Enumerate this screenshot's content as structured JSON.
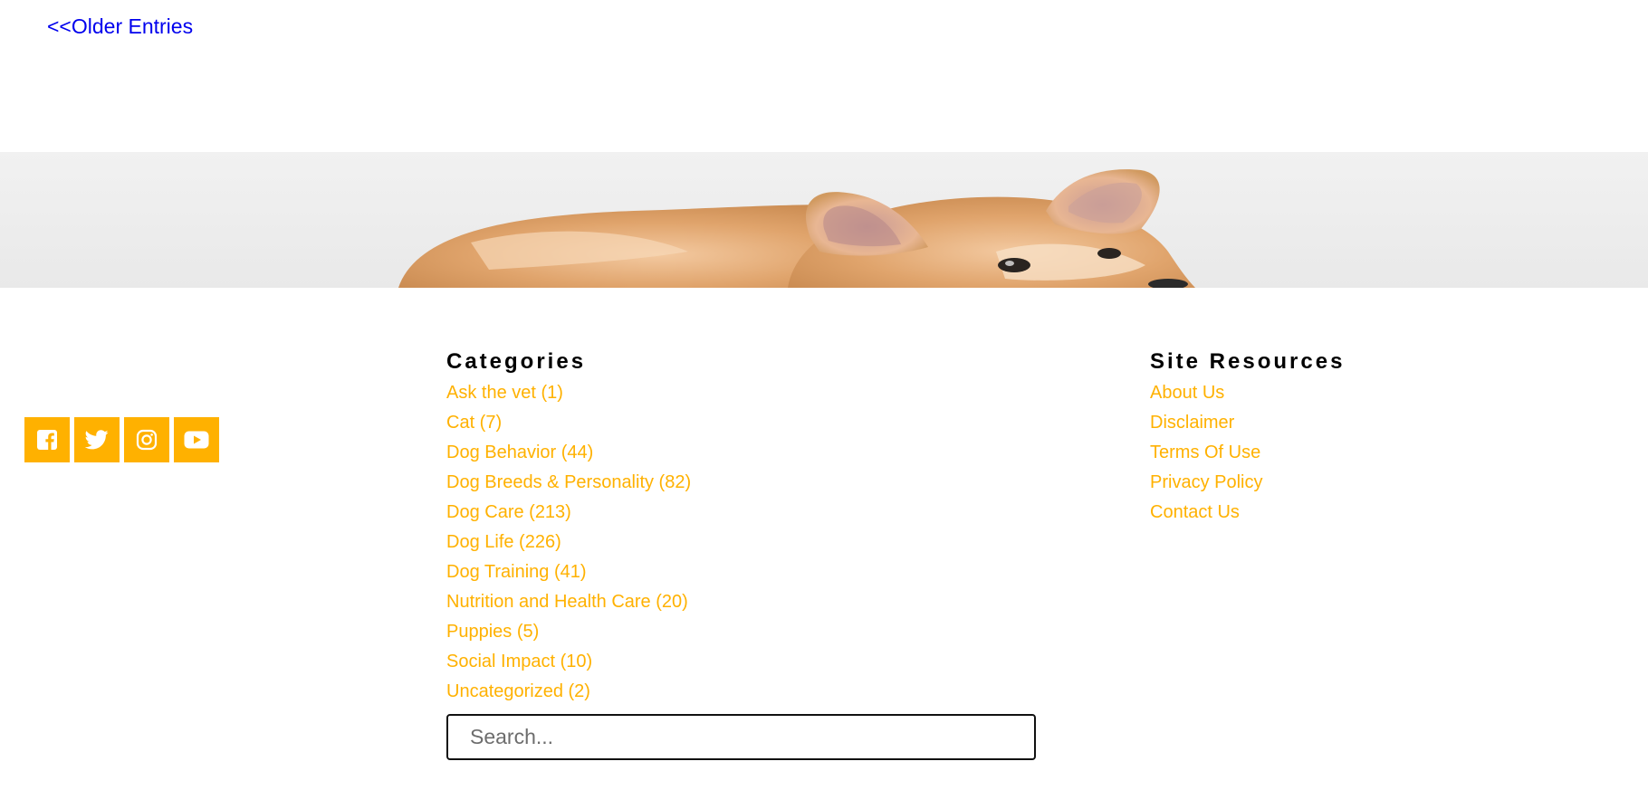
{
  "pagination": {
    "older_entries": "<<Older Entries"
  },
  "social": [
    {
      "icon": "facebook-icon",
      "color": "#ffb100"
    },
    {
      "icon": "twitter-icon",
      "color": "#ffb100"
    },
    {
      "icon": "instagram-icon",
      "color": "#ffb100"
    },
    {
      "icon": "youtube-icon",
      "color": "#ffb100"
    }
  ],
  "categories": {
    "heading": "Categories",
    "items": [
      {
        "label": "Ask the vet (1)"
      },
      {
        "label": "Cat (7)"
      },
      {
        "label": "Dog Behavior (44)"
      },
      {
        "label": "Dog Breeds & Personality (82)"
      },
      {
        "label": "Dog Care (213)"
      },
      {
        "label": "Dog Life (226)"
      },
      {
        "label": "Dog Training (41)"
      },
      {
        "label": "Nutrition and Health Care (20)"
      },
      {
        "label": "Puppies (5)"
      },
      {
        "label": "Social Impact (10)"
      },
      {
        "label": "Uncategorized (2)"
      }
    ]
  },
  "search": {
    "placeholder": "Search..."
  },
  "resources": {
    "heading": "Site Resources",
    "items": [
      {
        "label": "About Us"
      },
      {
        "label": "Disclaimer"
      },
      {
        "label": "Terms Of Use"
      },
      {
        "label": "Privacy Policy"
      },
      {
        "label": "Contact Us"
      }
    ]
  },
  "colors": {
    "accent": "#ffb100",
    "link": "#0000ee",
    "heading": "#000000"
  }
}
